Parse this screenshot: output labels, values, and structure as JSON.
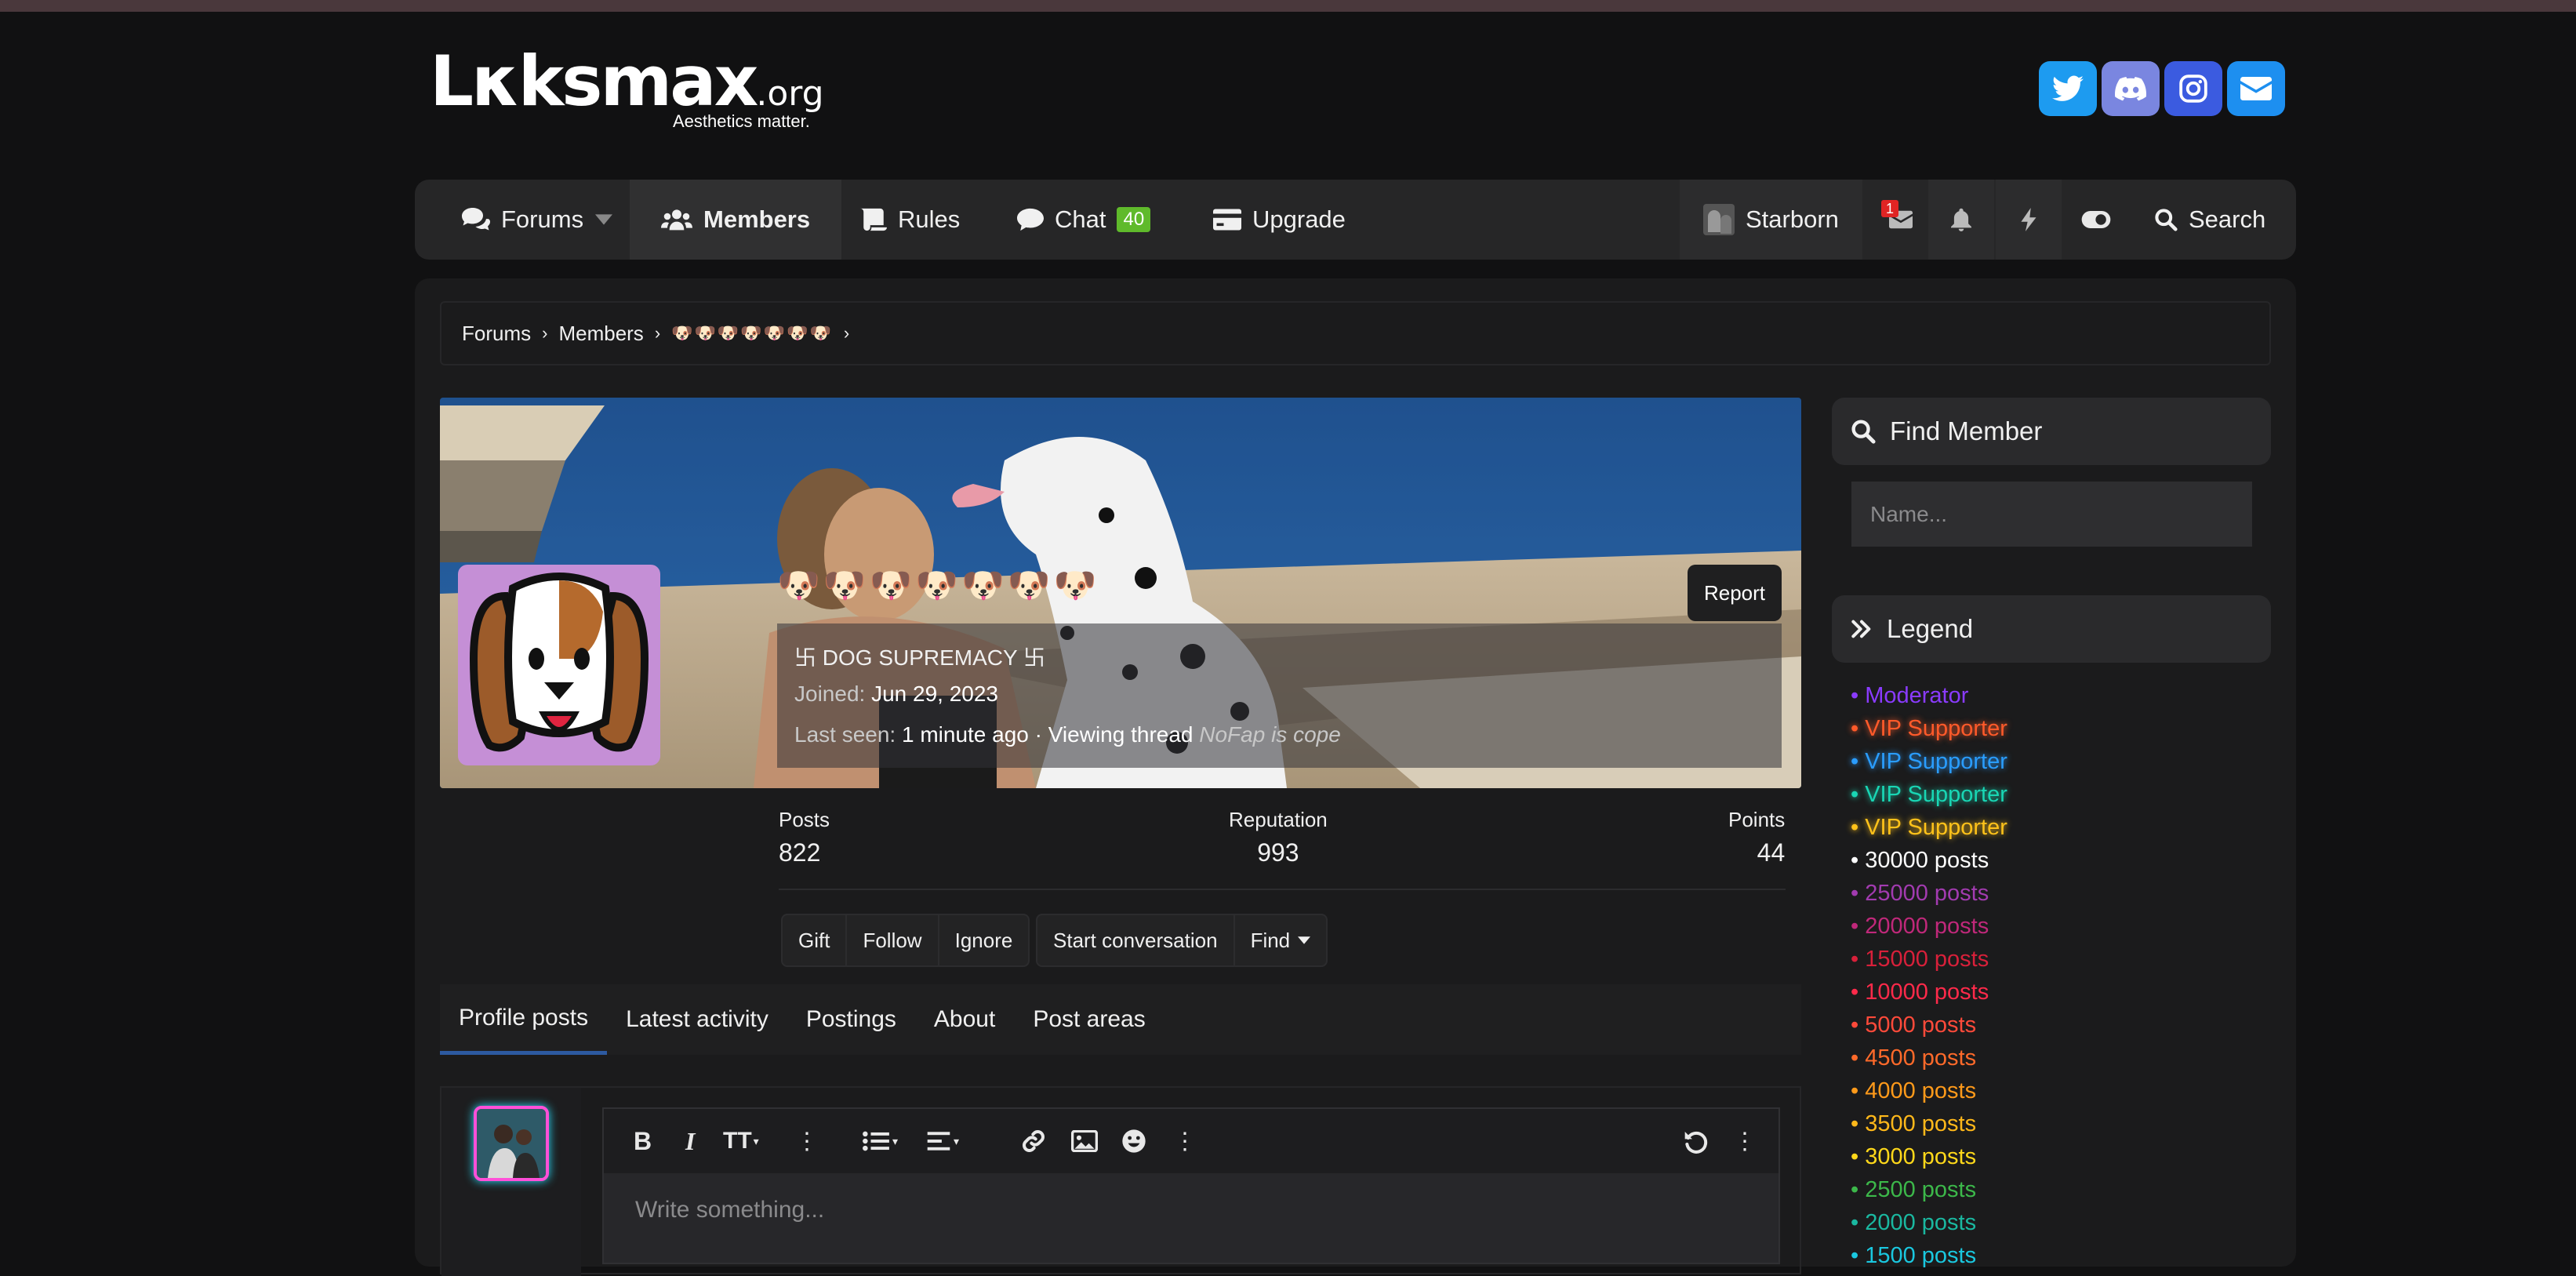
{
  "header": {
    "logo_main": "Lκksmax",
    "logo_suffix": ".org",
    "tagline": "Aesthetics matter.",
    "social": [
      {
        "icon": "twitter-icon",
        "color": "#1d9bf0"
      },
      {
        "icon": "discord-icon",
        "color": "#7a86e0"
      },
      {
        "icon": "instagram-icon",
        "color": "#3b5be0"
      },
      {
        "icon": "mail-icon",
        "color": "#1d8ff0"
      }
    ]
  },
  "nav": {
    "forums": "Forums",
    "members": "Members",
    "rules": "Rules",
    "chat": "Chat",
    "chat_count": "40",
    "upgrade": "Upgrade",
    "username": "Starborn",
    "inbox_badge": "1",
    "search": "Search"
  },
  "breadcrumb": {
    "items": [
      "Forums",
      "Members"
    ],
    "profile_name": "🐶🐶🐶🐶🐶🐶🐶"
  },
  "profile": {
    "name_emojis": "🐶🐶🐶🐶🐶🐶🐶",
    "title": "卐 DOG SUPREMACY 卐",
    "joined_label": "Joined:",
    "joined_value": "Jun 29, 2023",
    "lastseen_label": "Last seen:",
    "lastseen_value": "1 minute ago",
    "viewing": "· Viewing thread",
    "thread": "NoFap is cope",
    "report": "Report"
  },
  "stats": {
    "posts_label": "Posts",
    "posts_value": "822",
    "rep_label": "Reputation",
    "rep_value": "993",
    "points_label": "Points",
    "points_value": "44"
  },
  "actions": {
    "gift": "Gift",
    "follow": "Follow",
    "ignore": "Ignore",
    "start_conversation": "Start conversation",
    "find": "Find"
  },
  "tabs": [
    "Profile posts",
    "Latest activity",
    "Postings",
    "About",
    "Post areas"
  ],
  "editor": {
    "placeholder": "Write something..."
  },
  "sidebar": {
    "find_member_title": "Find Member",
    "name_placeholder": "Name...",
    "legend_title": "Legend",
    "legend": [
      {
        "label": "Moderator",
        "color": "#8a3bff"
      },
      {
        "label": "VIP Supporter",
        "color": "#ff5a2a"
      },
      {
        "label": "VIP Supporter",
        "color": "#2a9dff"
      },
      {
        "label": "VIP Supporter",
        "color": "#19d6b4"
      },
      {
        "label": "VIP Supporter",
        "color": "#ffc21a"
      },
      {
        "label": "30000 posts",
        "color": "#ffffff"
      },
      {
        "label": "25000 posts",
        "color": "#a23bb0"
      },
      {
        "label": "20000 posts",
        "color": "#c0287a"
      },
      {
        "label": "15000 posts",
        "color": "#d8203a"
      },
      {
        "label": "10000 posts",
        "color": "#ff2a4a"
      },
      {
        "label": "5000 posts",
        "color": "#ff4a3a"
      },
      {
        "label": "4500 posts",
        "color": "#ff6a2a"
      },
      {
        "label": "4000 posts",
        "color": "#ff9a1a"
      },
      {
        "label": "3500 posts",
        "color": "#ffb81a"
      },
      {
        "label": "3000 posts",
        "color": "#ffd81a"
      },
      {
        "label": "2500 posts",
        "color": "#3cb84a"
      },
      {
        "label": "2000 posts",
        "color": "#1ab8a0"
      },
      {
        "label": "1500 posts",
        "color": "#1ac8e0"
      }
    ]
  }
}
